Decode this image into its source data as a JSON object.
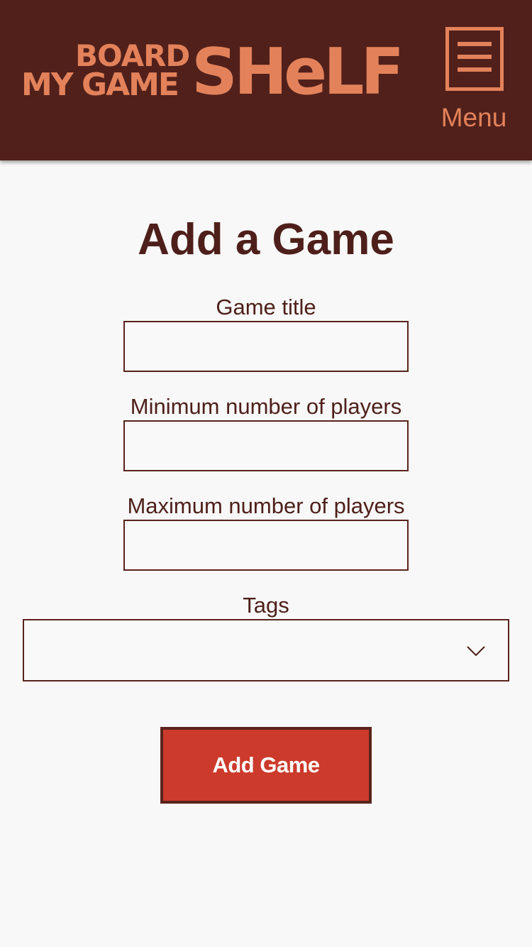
{
  "header": {
    "logo": {
      "line1": "BOARD",
      "line2": "MY GAME",
      "word": "SHeLF"
    },
    "menu_label": "Menu",
    "menu_icon": "hamburger-icon"
  },
  "page": {
    "title": "Add a Game"
  },
  "form": {
    "title_label": "Game title",
    "title_value": "",
    "min_label": "Minimum number of players",
    "min_value": "",
    "max_label": "Maximum number of players",
    "max_value": "",
    "tags_label": "Tags",
    "tags_value": "",
    "tags_icon": "chevron-down-icon",
    "submit_label": "Add Game"
  },
  "colors": {
    "header_bg": "#51201b",
    "accent": "#e3825a",
    "text": "#4e1f1a",
    "button_bg": "#cc3a2c",
    "page_bg": "#f7f8f7"
  }
}
